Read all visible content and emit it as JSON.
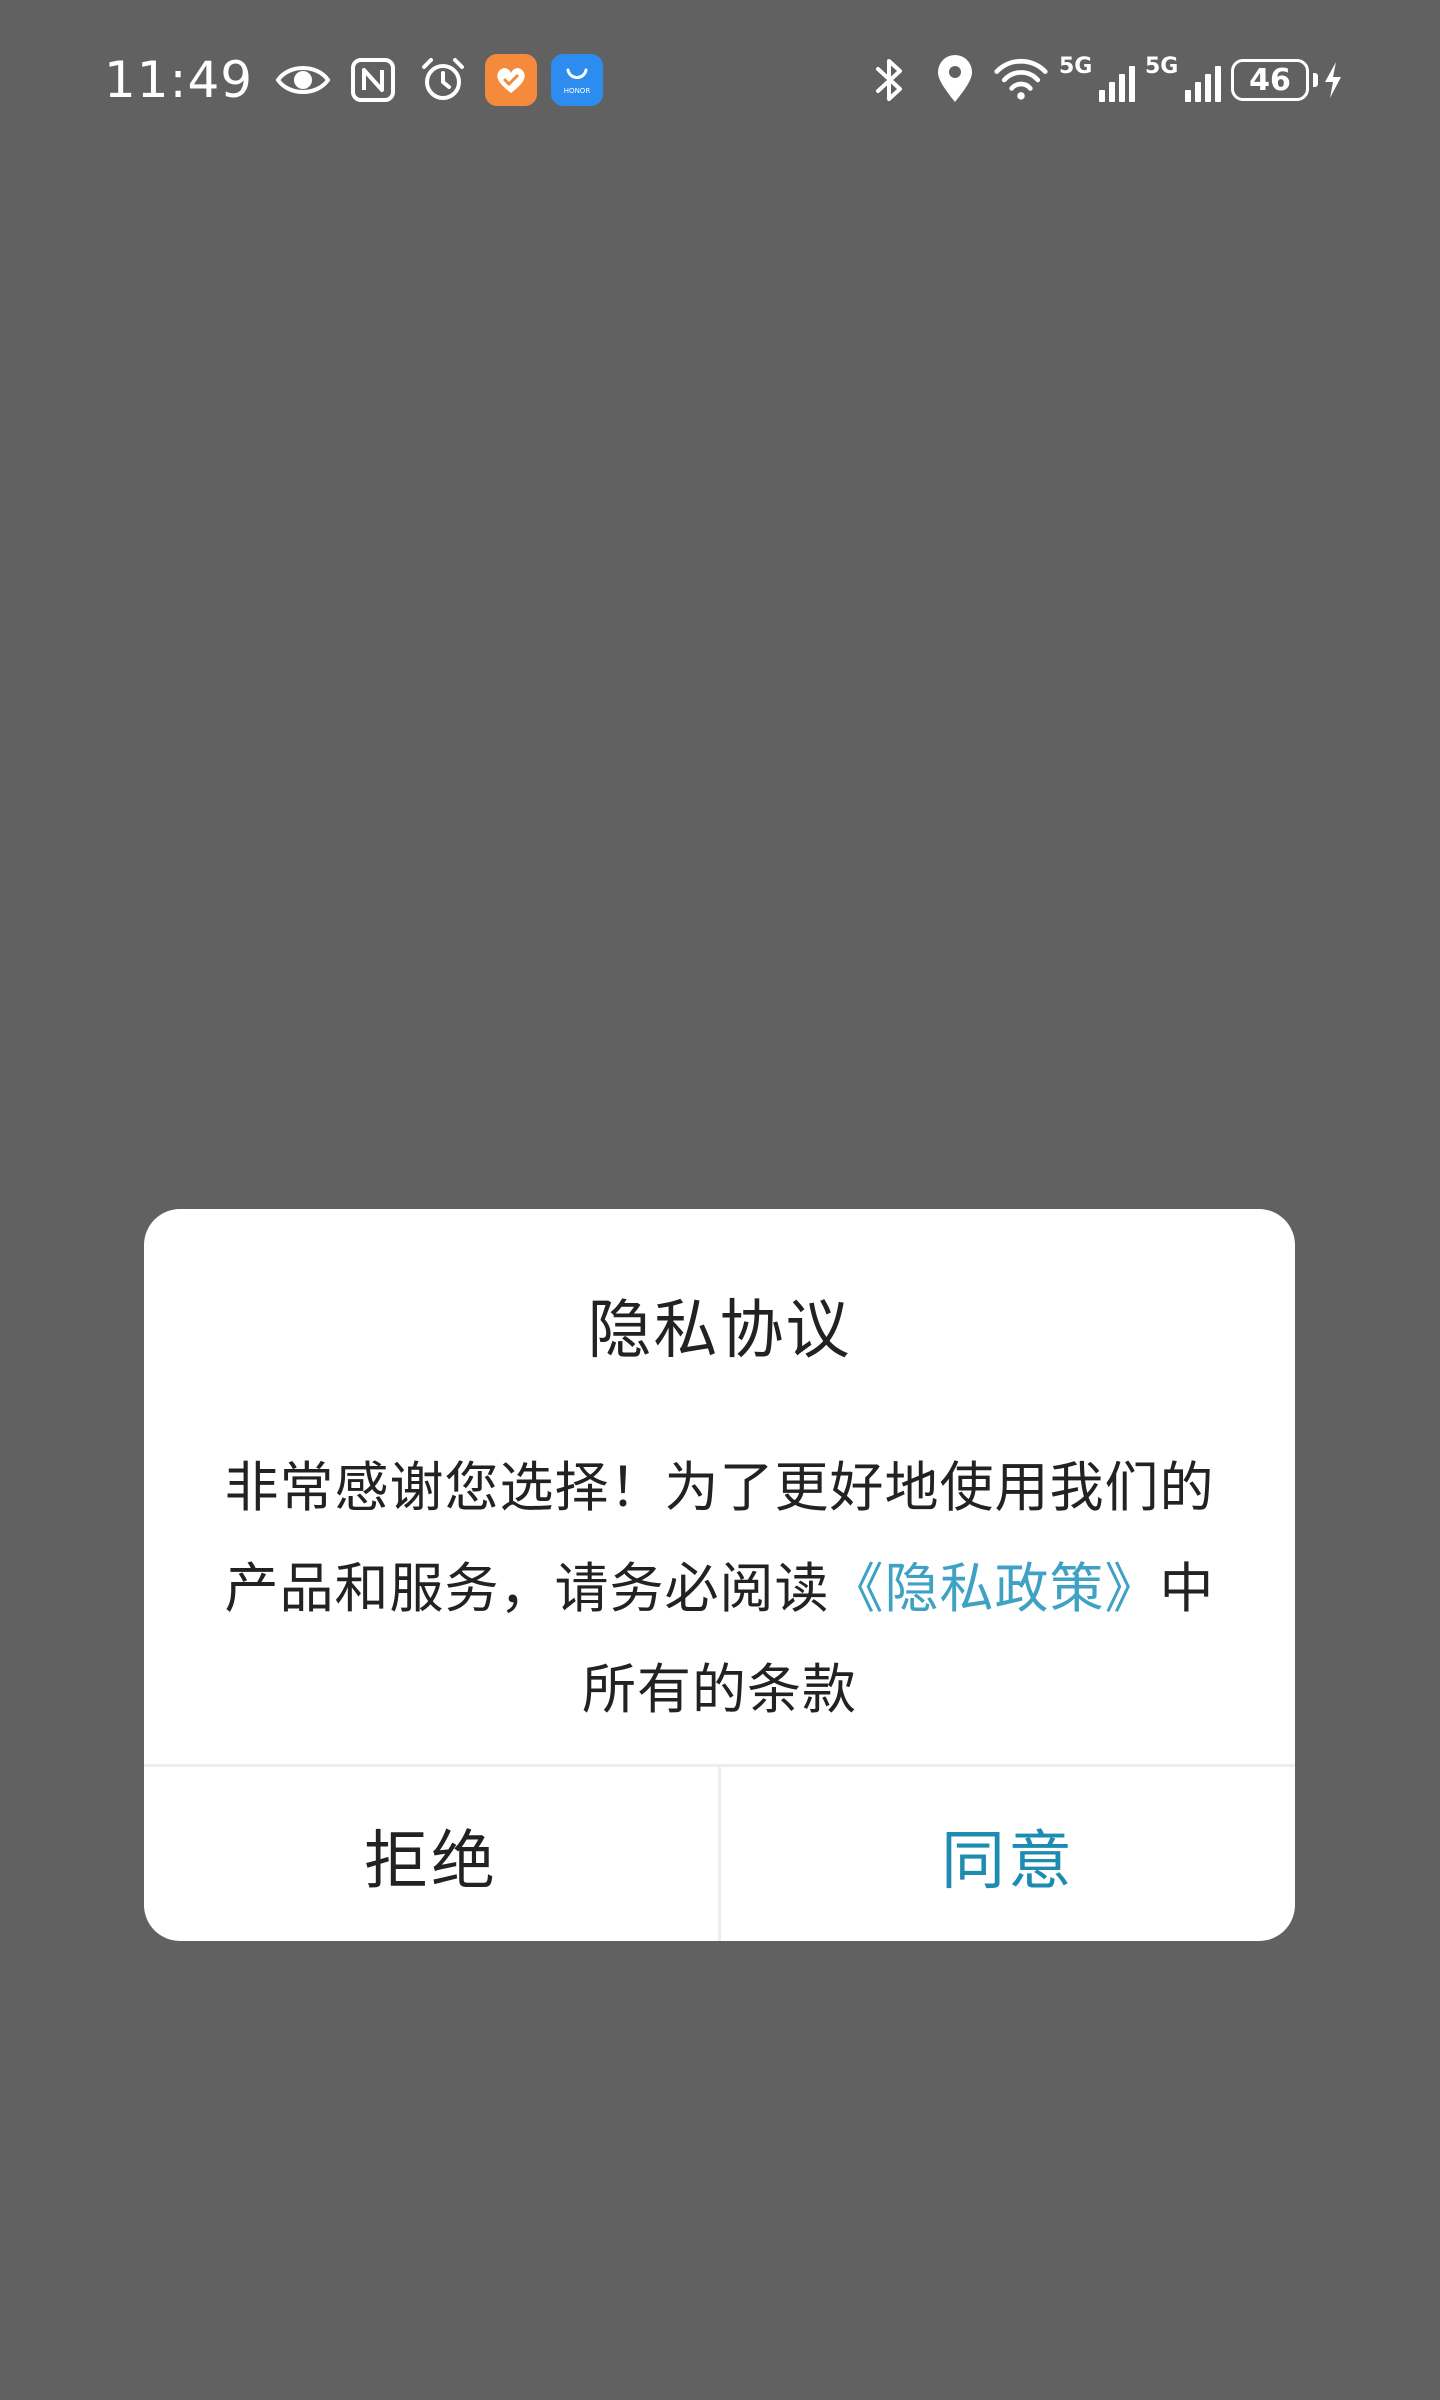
{
  "status_bar": {
    "time": "11:49",
    "left_icons": [
      "eye-icon",
      "nfc-icon",
      "alarm-icon",
      "health-app-icon",
      "honor-store-app-icon"
    ],
    "honor_label": "HONOR",
    "signal_1_tag": "5G",
    "signal_2_tag": "5G",
    "battery_level": "46",
    "charging": true
  },
  "dialog": {
    "title": "隐私协议",
    "message_before": "非常感谢您选择！为了更好地使用我们的产品和服务，请务必阅读",
    "policy_link": "《隐私政策》",
    "message_after": "中所有的条款",
    "reject_label": "拒绝",
    "agree_label": "同意"
  },
  "colors": {
    "overlay": "#616161",
    "link": "#3fa2c4",
    "agree": "#1e8bb0",
    "app_orange": "#f58a3c",
    "app_blue": "#2d8cf0"
  }
}
